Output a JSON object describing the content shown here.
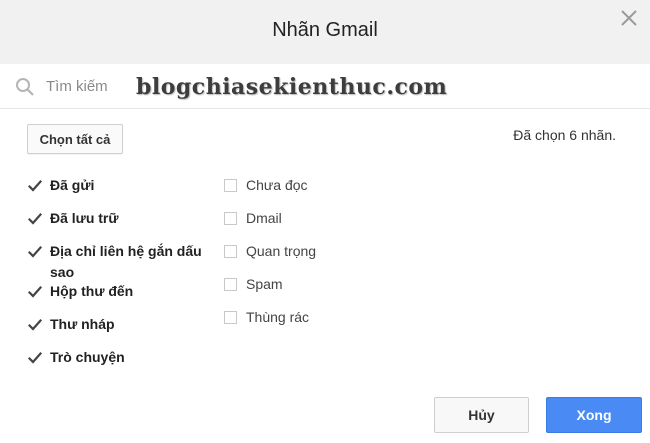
{
  "dialog": {
    "title": "Nhãn Gmail",
    "close_icon": "close-icon"
  },
  "search": {
    "icon": "search-icon",
    "placeholder": "Tìm kiếm",
    "value": ""
  },
  "watermark": "blogchiasekienthuc.com",
  "select_all_label": "Chọn tất cả",
  "status_text": "Đã chọn 6 nhãn.",
  "labels_left": [
    {
      "label": "Đã gửi",
      "checked": true
    },
    {
      "label": "Đã lưu trữ",
      "checked": true
    },
    {
      "label": "Địa chỉ liên hệ gắn dấu sao",
      "checked": true
    },
    {
      "label": "Hộp thư đến",
      "checked": true
    },
    {
      "label": "Thư nháp",
      "checked": true
    },
    {
      "label": "Trò chuyện",
      "checked": true
    }
  ],
  "labels_right": [
    {
      "label": "Chưa đọc",
      "checked": false
    },
    {
      "label": "Dmail",
      "checked": false
    },
    {
      "label": "Quan trọng",
      "checked": false
    },
    {
      "label": "Spam",
      "checked": false
    },
    {
      "label": "Thùng rác",
      "checked": false
    }
  ],
  "buttons": {
    "cancel": "Hủy",
    "done": "Xong"
  },
  "colors": {
    "header_bg": "#f1f1f1",
    "primary": "#4a8af4",
    "check": "#444444"
  }
}
